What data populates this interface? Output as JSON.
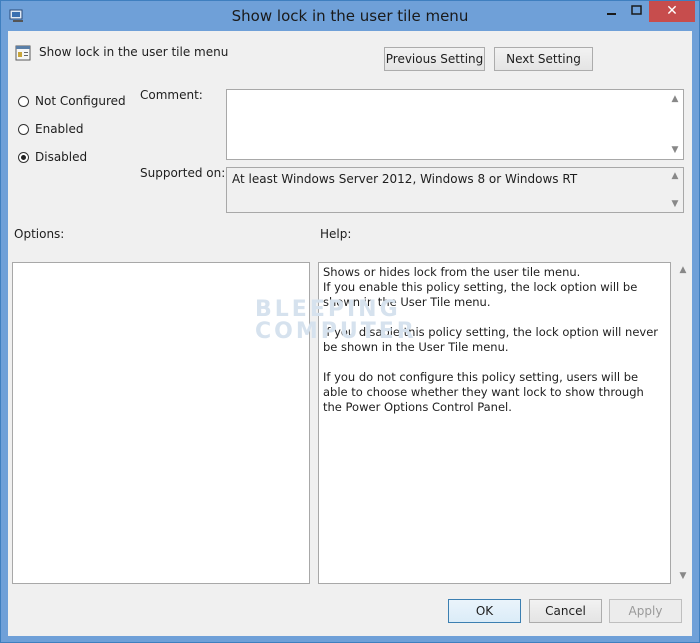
{
  "window": {
    "title": "Show lock in the user tile menu",
    "close_glyph": "✕"
  },
  "header": {
    "setting_name": "Show lock in the user tile menu",
    "previous_button": "Previous Setting",
    "next_button": "Next Setting"
  },
  "state": {
    "options": [
      {
        "label": "Not Configured",
        "checked": false
      },
      {
        "label": "Enabled",
        "checked": false
      },
      {
        "label": "Disabled",
        "checked": true
      }
    ]
  },
  "comment": {
    "label": "Comment:",
    "value": ""
  },
  "supported": {
    "label": "Supported on:",
    "value": "At least Windows Server 2012, Windows 8 or Windows RT"
  },
  "options_panel": {
    "label": "Options:"
  },
  "help_panel": {
    "label": "Help:",
    "paragraphs": [
      "Shows or hides lock from the user tile menu.\nIf you enable this policy setting, the lock option will be shown in the User Tile menu.",
      "If you disable this policy setting, the lock option will never be shown in the User Tile menu.",
      "If you do not configure this policy setting, users will be able to choose whether they want lock to show through the Power Options Control Panel."
    ]
  },
  "watermark": {
    "line1": "BLEEPING",
    "line2": "COMPUTER"
  },
  "footer": {
    "ok": "OK",
    "cancel": "Cancel",
    "apply": "Apply"
  }
}
